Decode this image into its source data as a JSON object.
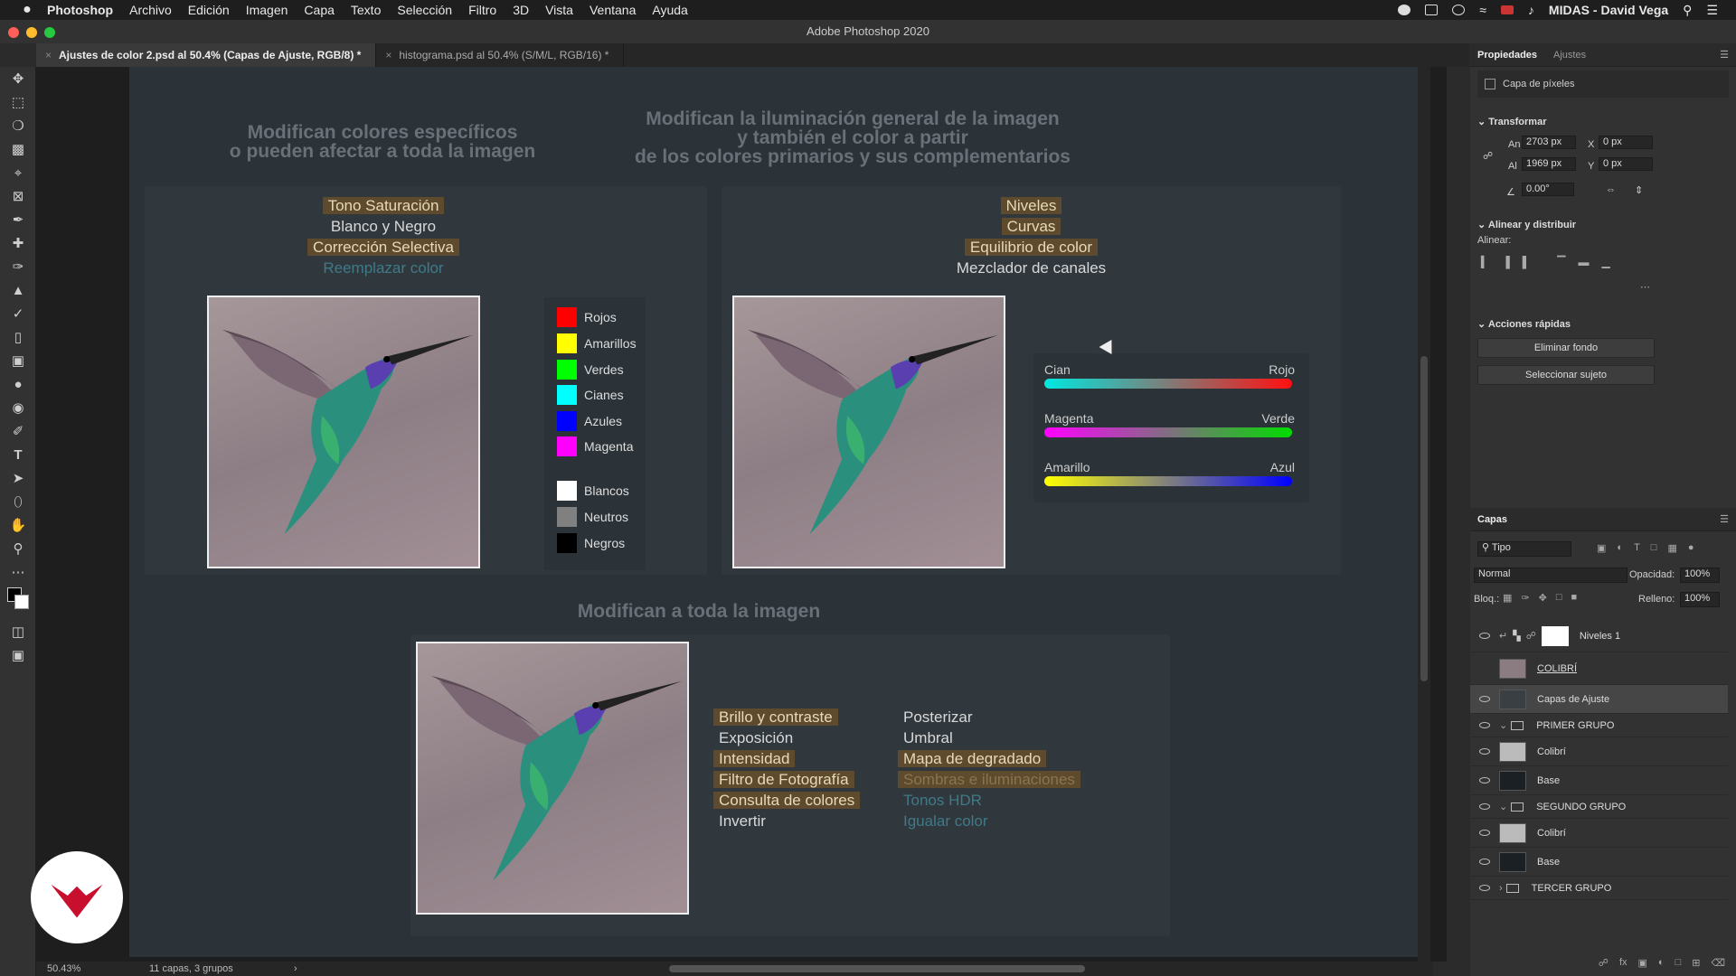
{
  "menubar": {
    "app": "Photoshop",
    "items": [
      "Archivo",
      "Edición",
      "Imagen",
      "Capa",
      "Texto",
      "Selección",
      "Filtro",
      "3D",
      "Vista",
      "Ventana",
      "Ayuda"
    ],
    "user": "MIDAS - David Vega"
  },
  "window": {
    "title": "Adobe Photoshop 2020"
  },
  "tabs": [
    {
      "label": "Ajustes de color 2.psd al 50.4% (Capas de Ajuste, RGB/8) *",
      "active": true
    },
    {
      "label": "histograma.psd al 50.4% (S/M/L, RGB/16) *",
      "active": false
    }
  ],
  "doc": {
    "left_heading": [
      "Modifican colores específicos",
      "o pueden afectar a toda la imagen"
    ],
    "right_heading": [
      "Modifican la iluminación general de la imagen",
      "y también el color a partir",
      "de los colores primarios y sus complementarios"
    ],
    "bottom_heading": "Modifican a toda la imagen",
    "left_list": [
      {
        "text": "Tono Saturación",
        "style": "hl"
      },
      {
        "text": "Blanco y Negro",
        "style": "pl"
      },
      {
        "text": "Corrección Selectiva",
        "style": "hl"
      },
      {
        "text": "Reemplazar color",
        "style": "dim"
      }
    ],
    "right_list": [
      {
        "text": "Niveles",
        "style": "hl"
      },
      {
        "text": "Curvas",
        "style": "hl"
      },
      {
        "text": "Equilibrio de color",
        "style": "hl"
      },
      {
        "text": "Mezclador de canales",
        "style": "pl"
      }
    ],
    "swatches": [
      {
        "name": "Rojos",
        "color": "#ff0000"
      },
      {
        "name": "Amarillos",
        "color": "#ffff00"
      },
      {
        "name": "Verdes",
        "color": "#00ff00"
      },
      {
        "name": "Cianes",
        "color": "#00ffff"
      },
      {
        "name": "Azules",
        "color": "#0000ff"
      },
      {
        "name": "Magenta",
        "color": "#ff00ff"
      },
      {
        "name": "Blancos",
        "color": "#ffffff"
      },
      {
        "name": "Neutros",
        "color": "#808080"
      },
      {
        "name": "Negros",
        "color": "#000000"
      }
    ],
    "sliders": [
      {
        "left": "Cian",
        "right": "Rojo",
        "from": "#00e8e0",
        "to": "#ff1010"
      },
      {
        "left": "Magenta",
        "right": "Verde",
        "from": "#ff00ff",
        "to": "#00dd00"
      },
      {
        "left": "Amarillo",
        "right": "Azul",
        "from": "#ffff00",
        "to": "#0000ff"
      }
    ],
    "bottom_col1": [
      {
        "text": "Brillo y contraste",
        "style": "hl"
      },
      {
        "text": "Exposición",
        "style": "pl"
      },
      {
        "text": "Intensidad",
        "style": "hl"
      },
      {
        "text": "Filtro de Fotografía",
        "style": "hl"
      },
      {
        "text": "Consulta de colores",
        "style": "hl"
      },
      {
        "text": "Invertir",
        "style": "pl"
      }
    ],
    "bottom_col2": [
      {
        "text": "Posterizar",
        "style": "pl"
      },
      {
        "text": "Umbral",
        "style": "pl"
      },
      {
        "text": "Mapa de degradado",
        "style": "hl"
      },
      {
        "text": "Sombras e iluminaciones",
        "style": "hl dim2"
      },
      {
        "text": "Tonos HDR",
        "style": "dim"
      },
      {
        "text": "Igualar color",
        "style": "dim"
      }
    ]
  },
  "status": {
    "zoom": "50.43%",
    "info": "11 capas, 3 grupos"
  },
  "properties": {
    "tabs": [
      "Propiedades",
      "Ajustes"
    ],
    "kind": "Capa de píxeles",
    "transform_title": "Transformar",
    "an_label": "An",
    "an": "2703 px",
    "al_label": "Al",
    "al": "1969 px",
    "x_label": "X",
    "x": "0 px",
    "y_label": "Y",
    "y": "0 px",
    "angle": "0.00°",
    "align_title": "Alinear y distribuir",
    "align_label": "Alinear:",
    "quick_title": "Acciones rápidas",
    "btn_remove": "Eliminar fondo",
    "btn_select": "Seleccionar sujeto"
  },
  "layers": {
    "title": "Capas",
    "filter": "Tipo",
    "blend": "Normal",
    "opacity_label": "Opacidad:",
    "opacity": "100%",
    "lock_label": "Bloq.:",
    "fill_label": "Relleno:",
    "fill": "100%",
    "items": [
      {
        "name": "Niveles 1",
        "indent": 0,
        "type": "adj",
        "eye": true,
        "sel": false
      },
      {
        "name": "COLIBRÍ",
        "indent": 0,
        "type": "img",
        "eye": false,
        "sel": false
      },
      {
        "name": "Capas de Ajuste",
        "indent": 0,
        "type": "img",
        "eye": true,
        "sel": true
      },
      {
        "name": "PRIMER GRUPO",
        "indent": 0,
        "type": "group",
        "eye": true,
        "sel": false
      },
      {
        "name": "Colibrí",
        "indent": 1,
        "type": "img",
        "eye": true,
        "sel": false
      },
      {
        "name": "Base",
        "indent": 1,
        "type": "img",
        "eye": true,
        "sel": false
      },
      {
        "name": "SEGUNDO GRUPO",
        "indent": 0,
        "type": "group",
        "eye": true,
        "sel": false
      },
      {
        "name": "Colibrí",
        "indent": 1,
        "type": "img",
        "eye": true,
        "sel": false
      },
      {
        "name": "Base",
        "indent": 1,
        "type": "img",
        "eye": true,
        "sel": false
      },
      {
        "name": "TERCER GRUPO",
        "indent": 0,
        "type": "group",
        "eye": true,
        "sel": false
      }
    ]
  }
}
